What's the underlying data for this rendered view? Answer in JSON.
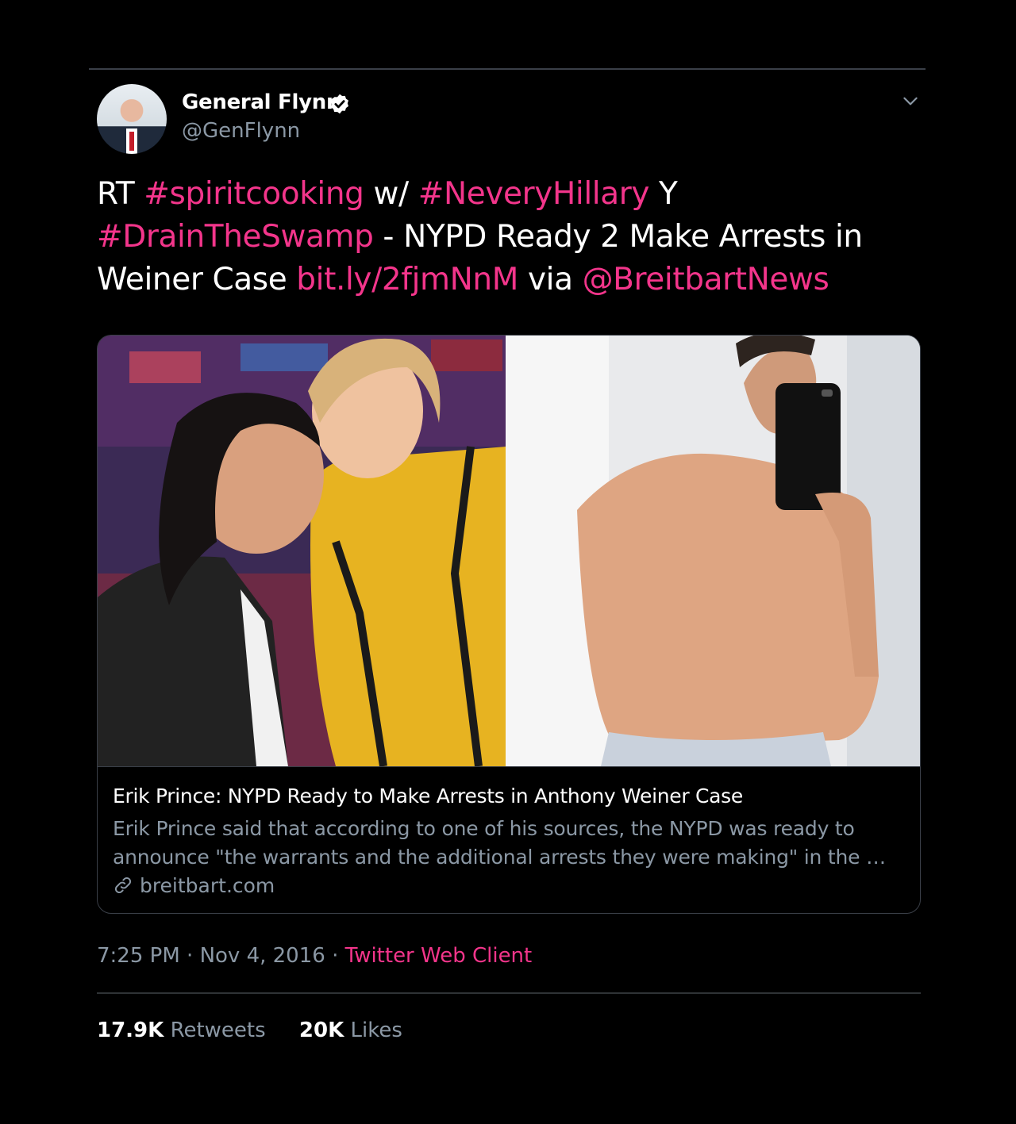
{
  "user": {
    "name": "General Flynn",
    "handle": "@GenFlynn"
  },
  "tweet": {
    "parts": [
      {
        "text": "RT ",
        "link": false
      },
      {
        "text": "#spiritcooking",
        "link": true
      },
      {
        "text": " w/ ",
        "link": false
      },
      {
        "text": "#NeveryHillary",
        "link": true
      },
      {
        "text": " Y ",
        "link": false
      },
      {
        "text": "#DrainTheSwamp",
        "link": true
      },
      {
        "text": " - NYPD Ready 2 Make Arrests in Weiner Case ",
        "link": false
      },
      {
        "text": "bit.ly/2fjmNnM",
        "link": true
      },
      {
        "text": " via ",
        "link": false
      },
      {
        "text": "@BreitbartNews",
        "link": true
      }
    ]
  },
  "card": {
    "title": "Erik Prince: NYPD Ready to Make Arrests in Anthony Weiner Case",
    "description": "Erik Prince said that according to one of his sources, the NYPD was ready to announce \"the warrants and the additional arrests they were making\" in the …",
    "domain": "breitbart.com"
  },
  "meta": {
    "time": "7:25 PM",
    "separator": " · ",
    "date": "Nov 4, 2016",
    "source": "Twitter Web Client"
  },
  "stats": {
    "retweets_count": "17.9K",
    "retweets_label": "Retweets",
    "likes_count": "20K",
    "likes_label": "Likes"
  },
  "colors": {
    "background": "#000000",
    "link": "#f3358b",
    "secondary": "#8b98a5",
    "verified": "#ffffff"
  },
  "icons": [
    "verified-badge-icon",
    "chevron-down-icon",
    "link-icon"
  ]
}
